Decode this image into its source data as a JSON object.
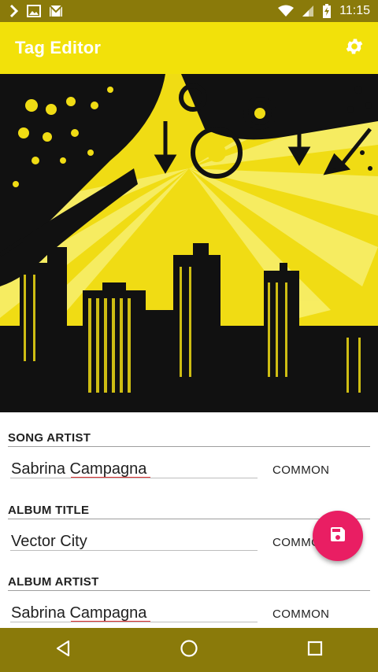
{
  "status_bar": {
    "time": "11:15",
    "left_icons": [
      "chevron-right-icon",
      "image-icon",
      "gmail-icon"
    ],
    "right_icons": [
      "wifi-icon",
      "signal-icon",
      "battery-charging-icon"
    ],
    "background": "#8a7a0a"
  },
  "app_bar": {
    "title": "Tag Editor",
    "settings_icon": "gear-icon",
    "background": "#f2e10a"
  },
  "artwork": {
    "description_icon": "album-art-image"
  },
  "fields": [
    {
      "label": "SONG ARTIST",
      "value": "Sabrina Campagna",
      "action": "COMMON"
    },
    {
      "label": "ALBUM TITLE",
      "value": "Vector City",
      "action": "COMMON"
    },
    {
      "label": "ALBUM ARTIST",
      "value": "Sabrina Campagna",
      "action": "COMMON"
    }
  ],
  "fab": {
    "icon": "save-icon",
    "color": "#e91e63"
  },
  "nav_bar": {
    "buttons": [
      "back-icon",
      "home-icon",
      "recents-icon"
    ],
    "background": "#8a7a0a"
  }
}
